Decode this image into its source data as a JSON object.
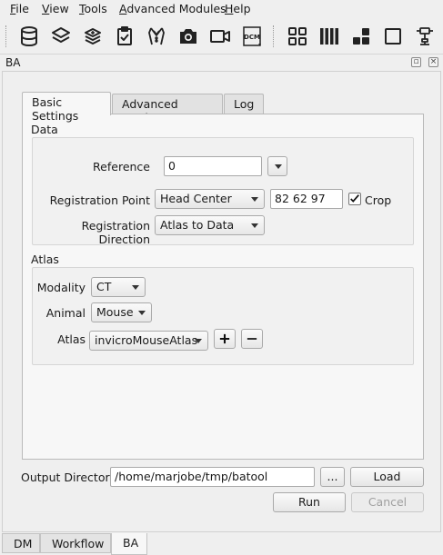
{
  "menu": [
    "File",
    "View",
    "Tools",
    "Advanced Modules",
    "Help"
  ],
  "toolbar_icons": [
    "database-icon",
    "layers-icon",
    "layers-add-icon",
    "clipboard-check-icon",
    "tuxedo-icon",
    "camera-icon",
    "video-camera-icon",
    "dicom-icon",
    "grid-four-icon",
    "columns-icon",
    "tile-layout-icon",
    "square-icon",
    "robot-arm-icon"
  ],
  "dock": {
    "title": "BA"
  },
  "tabs": [
    "Basic Settings",
    "Advanced Settings",
    "Log"
  ],
  "data_group": {
    "label": "Data",
    "reference_label": "Reference",
    "reference_value": "0",
    "registration_point_label": "Registration Point",
    "registration_point_value": "Head Center",
    "registration_point_coords": "82 62 97",
    "crop_label": "Crop",
    "crop_checked": true,
    "registration_direction_label": "Registration Direction",
    "registration_direction_value": "Atlas to Data"
  },
  "atlas_group": {
    "label": "Atlas",
    "modality_label": "Modality",
    "modality_value": "CT",
    "animal_label": "Animal",
    "animal_value": "Mouse",
    "atlas_label": "Atlas",
    "atlas_value": "invicroMouseAtlas"
  },
  "output": {
    "label": "Output Directory",
    "path": "/home/marjobe/tmp/batool",
    "browse_label": "...",
    "load_label": "Load",
    "run_label": "Run",
    "cancel_label": "Cancel"
  },
  "bottom_tabs": [
    "DM",
    "Workflow",
    "BA"
  ]
}
